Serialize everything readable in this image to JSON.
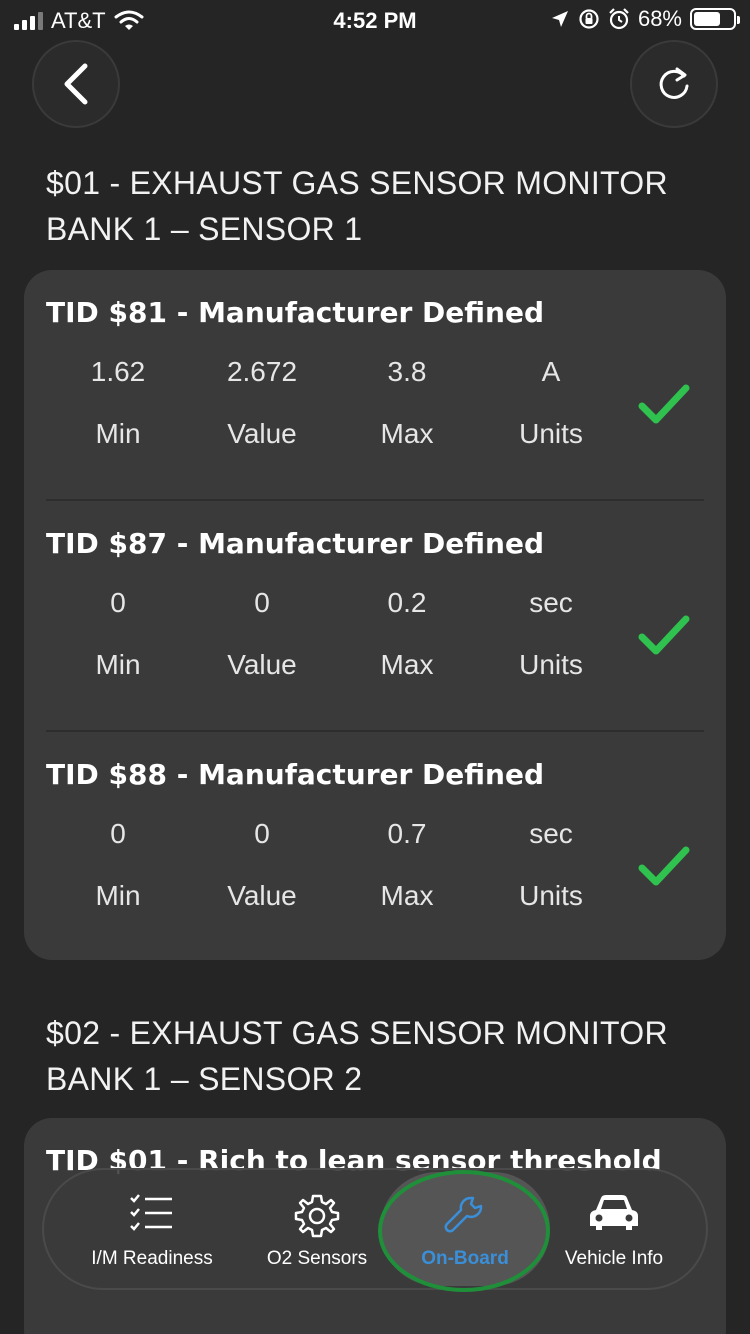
{
  "status_bar": {
    "carrier": "AT&T",
    "time": "4:52 PM",
    "battery": "68%",
    "battery_level": 0.68
  },
  "sections": [
    {
      "title_line1": "$01 - EXHAUST GAS SENSOR MONITOR",
      "title_line2": "BANK 1 – SENSOR 1",
      "tests": [
        {
          "title": "TID $81 - Manufacturer Defined",
          "min": "1.62",
          "value": "2.672",
          "max": "3.8",
          "units": "A",
          "status": "pass"
        },
        {
          "title": "TID $87 - Manufacturer Defined",
          "min": "0",
          "value": "0",
          "max": "0.2",
          "units": "sec",
          "status": "pass"
        },
        {
          "title": "TID $88 - Manufacturer Defined",
          "min": "0",
          "value": "0",
          "max": "0.7",
          "units": "sec",
          "status": "pass"
        }
      ]
    },
    {
      "title_line1": "$02 - EXHAUST GAS SENSOR MONITOR",
      "title_line2": "BANK 1 – SENSOR 2",
      "tests": [
        {
          "title": "TID $01 - Rich to lean sensor threshold"
        }
      ]
    }
  ],
  "labels": {
    "min": "Min",
    "value": "Value",
    "max": "Max",
    "units": "Units"
  },
  "tabbar": {
    "items": [
      {
        "label": "I/M Readiness",
        "icon": "checklist-icon"
      },
      {
        "label": "O2 Sensors",
        "icon": "gear-icon"
      },
      {
        "label": "On-Board",
        "icon": "wrench-icon",
        "active": true
      },
      {
        "label": "Vehicle Info",
        "icon": "car-icon"
      }
    ]
  },
  "colors": {
    "background": "#252525",
    "card": "#3a3a3a",
    "check": "#2fc24f",
    "active_tab": "#3a8fd8",
    "annotation_ring": "#1f8f3a"
  }
}
